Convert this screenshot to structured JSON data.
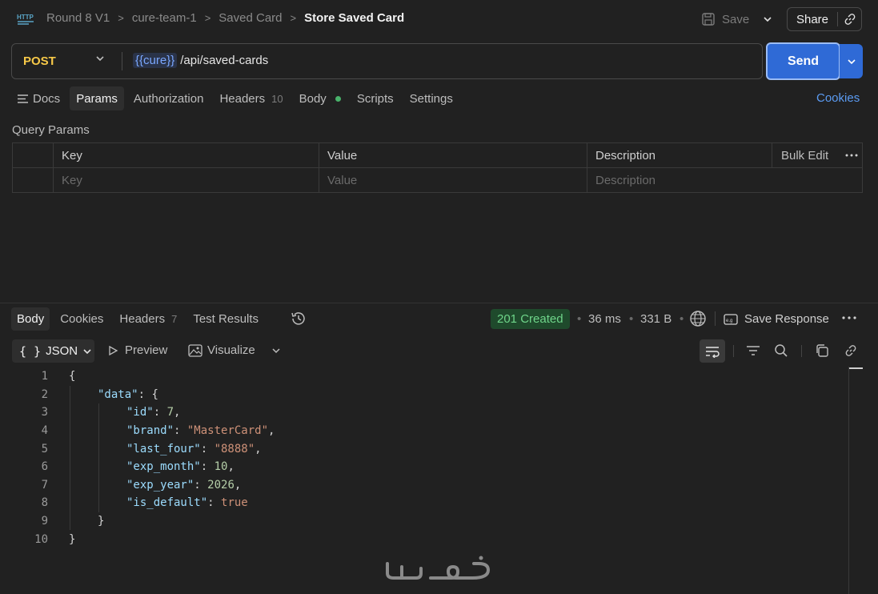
{
  "breadcrumb": {
    "items": [
      "Round 8 V1",
      "cure-team-1",
      "Saved Card"
    ],
    "current": "Store Saved Card"
  },
  "toolbar": {
    "save_label": "Save",
    "share_label": "Share"
  },
  "request": {
    "method": "POST",
    "url_variable": "{{cure}}",
    "url_path": "/api/saved-cards",
    "send_label": "Send"
  },
  "request_tabs": {
    "docs": "Docs",
    "params": "Params",
    "authorization": "Authorization",
    "headers": "Headers",
    "headers_count": "10",
    "body": "Body",
    "scripts": "Scripts",
    "settings": "Settings",
    "cookies": "Cookies"
  },
  "query_params": {
    "title": "Query Params",
    "headers": {
      "key": "Key",
      "value": "Value",
      "description": "Description",
      "bulk_edit": "Bulk Edit"
    },
    "placeholders": {
      "key": "Key",
      "value": "Value",
      "description": "Description"
    }
  },
  "response_tabs": {
    "body": "Body",
    "cookies": "Cookies",
    "headers": "Headers",
    "headers_count": "7",
    "test_results": "Test Results"
  },
  "response_meta": {
    "status": "201 Created",
    "time": "36 ms",
    "size": "331 B",
    "save_response": "Save Response",
    "status_color": "#6fd58a"
  },
  "body_view": {
    "format": "JSON",
    "preview": "Preview",
    "visualize": "Visualize"
  },
  "code_lines": [
    {
      "n": "1",
      "text": "{"
    },
    {
      "n": "2",
      "key": "\"data\"",
      "sep": ": ",
      "val": "{",
      "valtype": "p"
    },
    {
      "n": "3",
      "key": "\"id\"",
      "sep": ": ",
      "val": "7",
      "valtype": "n",
      "tail": ","
    },
    {
      "n": "4",
      "key": "\"brand\"",
      "sep": ": ",
      "val": "\"MasterCard\"",
      "valtype": "s",
      "tail": ","
    },
    {
      "n": "5",
      "key": "\"last_four\"",
      "sep": ": ",
      "val": "\"8888\"",
      "valtype": "s",
      "tail": ","
    },
    {
      "n": "6",
      "key": "\"exp_month\"",
      "sep": ": ",
      "val": "10",
      "valtype": "n",
      "tail": ","
    },
    {
      "n": "7",
      "key": "\"exp_year\"",
      "sep": ": ",
      "val": "2026",
      "valtype": "n",
      "tail": ","
    },
    {
      "n": "8",
      "key": "\"is_default\"",
      "sep": ": ",
      "val": "true",
      "valtype": "b"
    },
    {
      "n": "9",
      "text": "}"
    },
    {
      "n": "10",
      "text": "}"
    }
  ],
  "watermark": "خمسات"
}
